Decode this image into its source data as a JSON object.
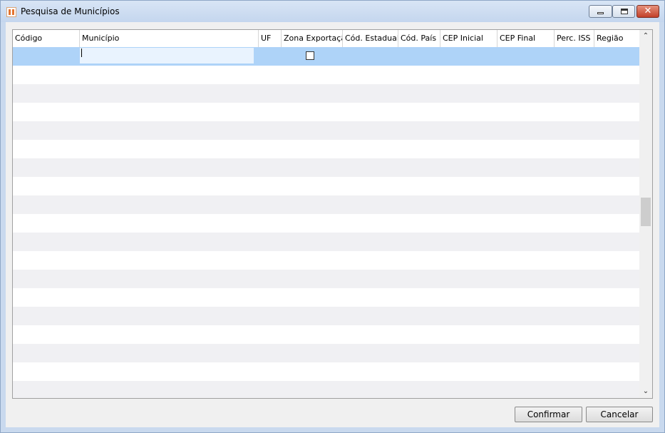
{
  "window": {
    "title": "Pesquisa de Municípios",
    "close_glyph": "✕"
  },
  "grid": {
    "columns": [
      "Código",
      "Município",
      "UF",
      "Zona Exportação",
      "Cód. Estadual",
      "Cód. País",
      "CEP Inicial",
      "CEP Final",
      "Perc. ISS",
      "Região"
    ],
    "selected_row": {
      "codigo": "",
      "municipio": "",
      "zona_exportacao_checked": false
    },
    "scroll_up_glyph": "⌃",
    "scroll_down_glyph": "⌄"
  },
  "buttons": {
    "confirm": "Confirmar",
    "cancel": "Cancelar"
  },
  "colors": {
    "selected_row": "#aed3f8",
    "alt_row": "#f0f0f3",
    "title_bar": "#c9d9ee",
    "close_button": "#c2402a"
  }
}
